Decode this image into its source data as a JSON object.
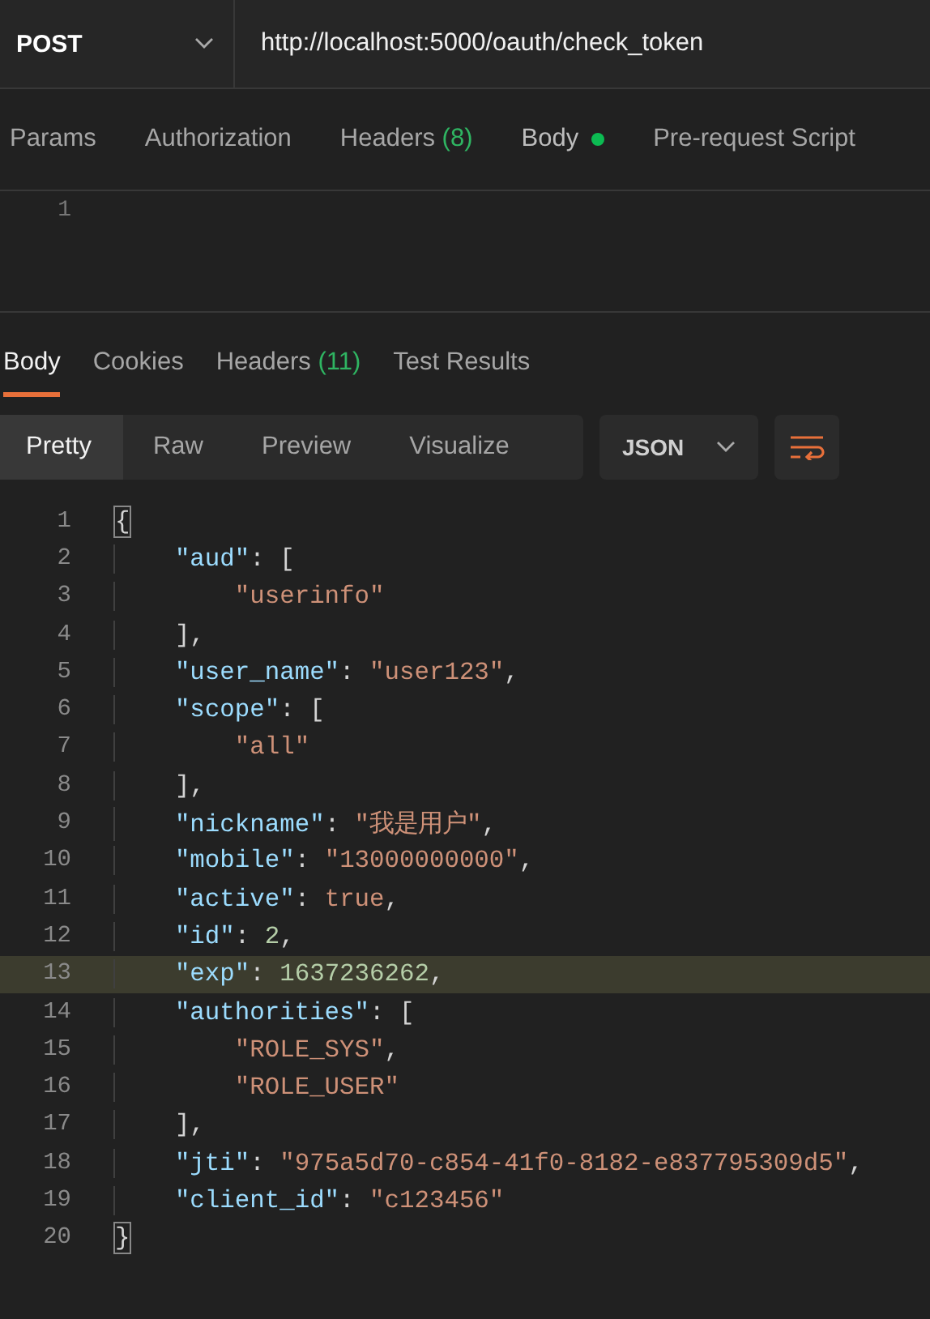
{
  "request": {
    "method": "POST",
    "url": "http://localhost:5000/oauth/check_token"
  },
  "request_tabs": [
    {
      "label": "Params",
      "selected": false
    },
    {
      "label": "Authorization",
      "selected": false
    },
    {
      "label": "Headers",
      "count": "(8)",
      "selected": false
    },
    {
      "label": "Body",
      "dot": true,
      "selected": true
    },
    {
      "label": "Pre-request Script",
      "selected": false
    }
  ],
  "request_editor": {
    "line_numbers": [
      "1"
    ]
  },
  "response_tabs": [
    {
      "label": "Body",
      "selected": true
    },
    {
      "label": "Cookies",
      "selected": false
    },
    {
      "label": "Headers",
      "count": "(11)",
      "selected": false
    },
    {
      "label": "Test Results",
      "selected": false
    }
  ],
  "view_modes": [
    {
      "label": "Pretty",
      "selected": true
    },
    {
      "label": "Raw",
      "selected": false
    },
    {
      "label": "Preview",
      "selected": false
    },
    {
      "label": "Visualize",
      "selected": false
    }
  ],
  "format": "JSON",
  "response_lines": [
    {
      "number": "1",
      "highlighted": false,
      "bracket": true,
      "tokens": [
        {
          "kind": "punct",
          "text": "{"
        }
      ]
    },
    {
      "number": "2",
      "highlighted": false,
      "tokens": [
        {
          "kind": "key",
          "text": "    \"aud\""
        },
        {
          "kind": "punct",
          "text": ": ["
        }
      ]
    },
    {
      "number": "3",
      "highlighted": false,
      "tokens": [
        {
          "kind": "str",
          "text": "        \"userinfo\""
        }
      ]
    },
    {
      "number": "4",
      "highlighted": false,
      "tokens": [
        {
          "kind": "punct",
          "text": "    ],"
        }
      ]
    },
    {
      "number": "5",
      "highlighted": false,
      "tokens": [
        {
          "kind": "key",
          "text": "    \"user_name\""
        },
        {
          "kind": "punct",
          "text": ": "
        },
        {
          "kind": "str",
          "text": "\"user123\""
        },
        {
          "kind": "punct",
          "text": ","
        }
      ]
    },
    {
      "number": "6",
      "highlighted": false,
      "tokens": [
        {
          "kind": "key",
          "text": "    \"scope\""
        },
        {
          "kind": "punct",
          "text": ": ["
        }
      ]
    },
    {
      "number": "7",
      "highlighted": false,
      "tokens": [
        {
          "kind": "str",
          "text": "        \"all\""
        }
      ]
    },
    {
      "number": "8",
      "highlighted": false,
      "tokens": [
        {
          "kind": "punct",
          "text": "    ],"
        }
      ]
    },
    {
      "number": "9",
      "highlighted": false,
      "tokens": [
        {
          "kind": "key",
          "text": "    \"nickname\""
        },
        {
          "kind": "punct",
          "text": ": "
        },
        {
          "kind": "str",
          "text": "\"我是用户\""
        },
        {
          "kind": "punct",
          "text": ","
        }
      ]
    },
    {
      "number": "10",
      "highlighted": false,
      "tokens": [
        {
          "kind": "key",
          "text": "    \"mobile\""
        },
        {
          "kind": "punct",
          "text": ": "
        },
        {
          "kind": "str",
          "text": "\"13000000000\""
        },
        {
          "kind": "punct",
          "text": ","
        }
      ]
    },
    {
      "number": "11",
      "highlighted": false,
      "tokens": [
        {
          "kind": "key",
          "text": "    \"active\""
        },
        {
          "kind": "punct",
          "text": ": "
        },
        {
          "kind": "bool",
          "text": "true"
        },
        {
          "kind": "punct",
          "text": ","
        }
      ]
    },
    {
      "number": "12",
      "highlighted": false,
      "tokens": [
        {
          "kind": "key",
          "text": "    \"id\""
        },
        {
          "kind": "punct",
          "text": ": "
        },
        {
          "kind": "num",
          "text": "2"
        },
        {
          "kind": "punct",
          "text": ","
        }
      ]
    },
    {
      "number": "13",
      "highlighted": true,
      "tokens": [
        {
          "kind": "key",
          "text": "    \"exp\""
        },
        {
          "kind": "punct",
          "text": ": "
        },
        {
          "kind": "num",
          "text": "1637236262"
        },
        {
          "kind": "punct",
          "text": ","
        }
      ]
    },
    {
      "number": "14",
      "highlighted": false,
      "tokens": [
        {
          "kind": "key",
          "text": "    \"authorities\""
        },
        {
          "kind": "punct",
          "text": ": ["
        }
      ]
    },
    {
      "number": "15",
      "highlighted": false,
      "tokens": [
        {
          "kind": "str",
          "text": "        \"ROLE_SYS\""
        },
        {
          "kind": "punct",
          "text": ","
        }
      ]
    },
    {
      "number": "16",
      "highlighted": false,
      "tokens": [
        {
          "kind": "str",
          "text": "        \"ROLE_USER\""
        }
      ]
    },
    {
      "number": "17",
      "highlighted": false,
      "tokens": [
        {
          "kind": "punct",
          "text": "    ],"
        }
      ]
    },
    {
      "number": "18",
      "highlighted": false,
      "tokens": [
        {
          "kind": "key",
          "text": "    \"jti\""
        },
        {
          "kind": "punct",
          "text": ": "
        },
        {
          "kind": "str",
          "text": "\"975a5d70-c854-41f0-8182-e837795309d5\""
        },
        {
          "kind": "punct",
          "text": ","
        }
      ]
    },
    {
      "number": "19",
      "highlighted": false,
      "tokens": [
        {
          "kind": "key",
          "text": "    \"client_id\""
        },
        {
          "kind": "punct",
          "text": ": "
        },
        {
          "kind": "str",
          "text": "\"c123456\""
        }
      ]
    },
    {
      "number": "20",
      "highlighted": false,
      "bracket": true,
      "tokens": [
        {
          "kind": "punct",
          "text": "}"
        }
      ]
    }
  ]
}
